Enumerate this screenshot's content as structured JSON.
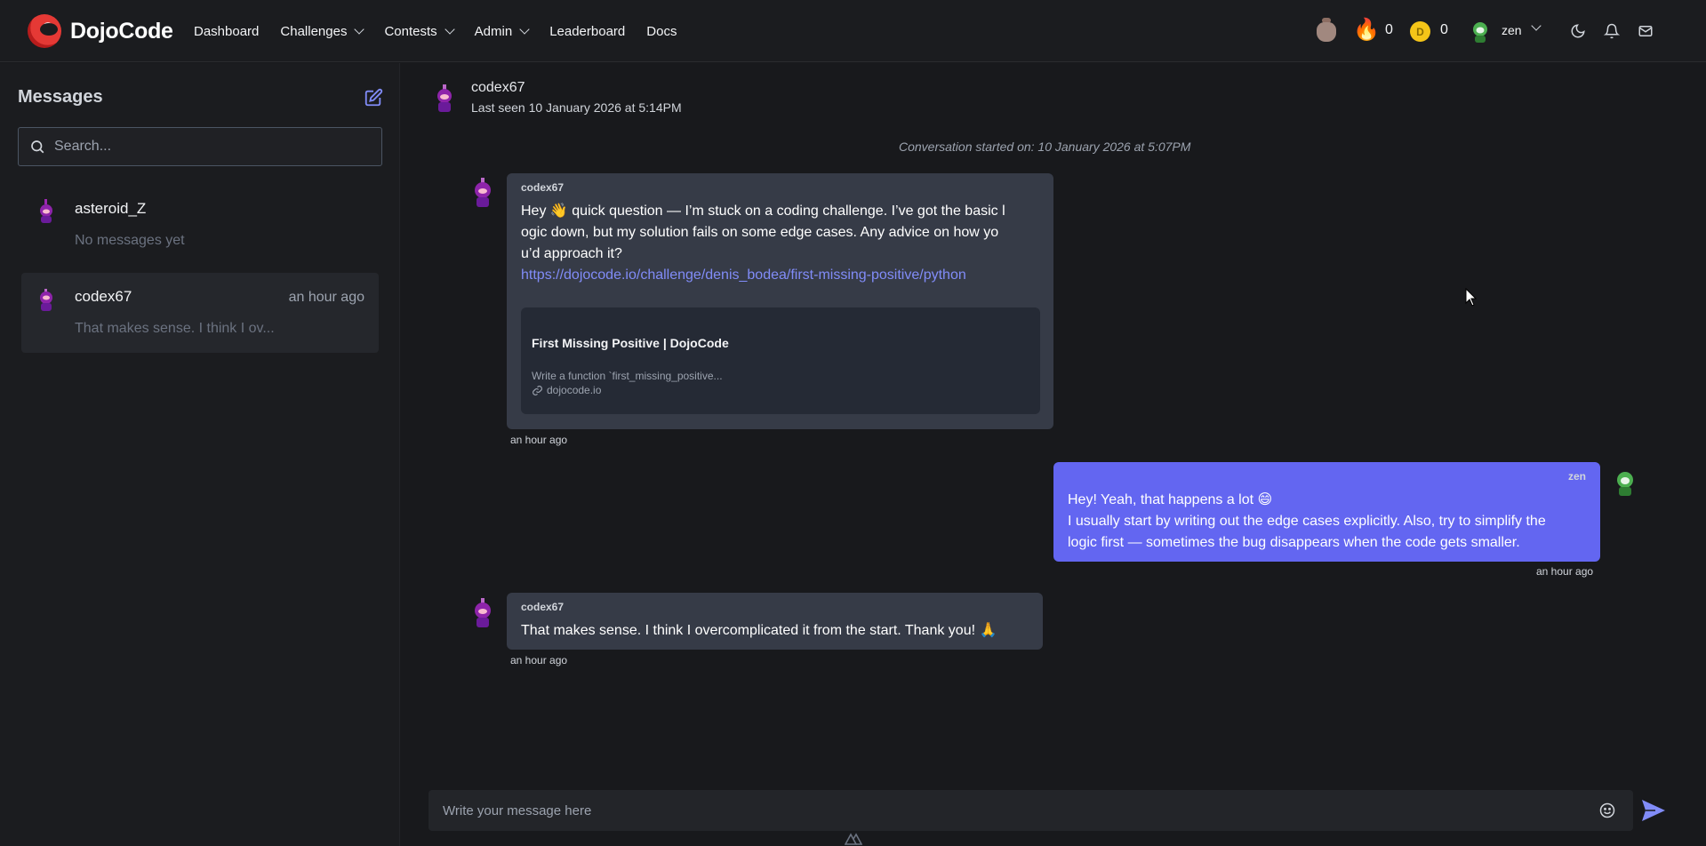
{
  "brand": {
    "name": "DojoCode"
  },
  "nav": {
    "items": [
      {
        "label": "Dashboard",
        "dropdown": false
      },
      {
        "label": "Challenges",
        "dropdown": true
      },
      {
        "label": "Contests",
        "dropdown": true
      },
      {
        "label": "Admin",
        "dropdown": true
      },
      {
        "label": "Leaderboard",
        "dropdown": false
      },
      {
        "label": "Docs",
        "dropdown": false
      }
    ],
    "streak_count": "0",
    "coin_letter": "D",
    "coin_count": "0",
    "username": "zen"
  },
  "sidebar": {
    "title": "Messages",
    "search_placeholder": "Search...",
    "conversations": [
      {
        "name": "asteroid_Z",
        "time": "",
        "preview": "No messages yet",
        "active": false
      },
      {
        "name": "codex67",
        "time": "an hour ago",
        "preview": "That makes sense. I think I ov...",
        "active": true
      }
    ]
  },
  "chat": {
    "contact_name": "codex67",
    "last_seen": "Last seen 10 January 2026 at 5:14PM",
    "conversation_started": "Conversation started on: 10 January 2026 at 5:07PM",
    "messages": [
      {
        "author": "codex67",
        "direction": "in",
        "lines": [
          "Hey 👋 quick question — I’m stuck on a coding challenge. I’ve got the basic l",
          "ogic down, but my solution fails on some edge cases. Any advice on how yo",
          "u’d approach it?"
        ],
        "link": "https://dojocode.io/challenge/denis_bodea/first-missing-positive/python",
        "preview": {
          "title": "First Missing Positive | DojoCode",
          "description": "Write a function `first_missing_positive...",
          "domain": "dojocode.io"
        },
        "time": "an hour ago"
      },
      {
        "author": "zen",
        "direction": "out",
        "lines": [
          "Hey! Yeah, that happens a lot 😄",
          "I usually start by writing out the edge cases explicitly. Also, try to simplify the",
          "logic first — sometimes the bug disappears when the code gets smaller."
        ],
        "time": "an hour ago"
      },
      {
        "author": "codex67",
        "direction": "in",
        "lines": [
          "That makes sense. I think I overcomplicated it from the start. Thank you! 🙏"
        ],
        "time": "an hour ago"
      }
    ],
    "input_placeholder": "Write your message here"
  },
  "colors": {
    "accent": "#6366f1",
    "link": "#818cf8",
    "incoming_bubble": "#363b47",
    "background": "#18191c"
  },
  "icons": {
    "bag": "money-bag-icon",
    "streak": "fire-icon",
    "coin": "coin-icon",
    "theme": "moon-icon",
    "notifications": "bell-icon",
    "mail": "envelope-icon",
    "compose": "edit-icon",
    "search": "search-icon",
    "emoji": "smiley-icon",
    "send": "send-icon",
    "link": "link-icon"
  }
}
